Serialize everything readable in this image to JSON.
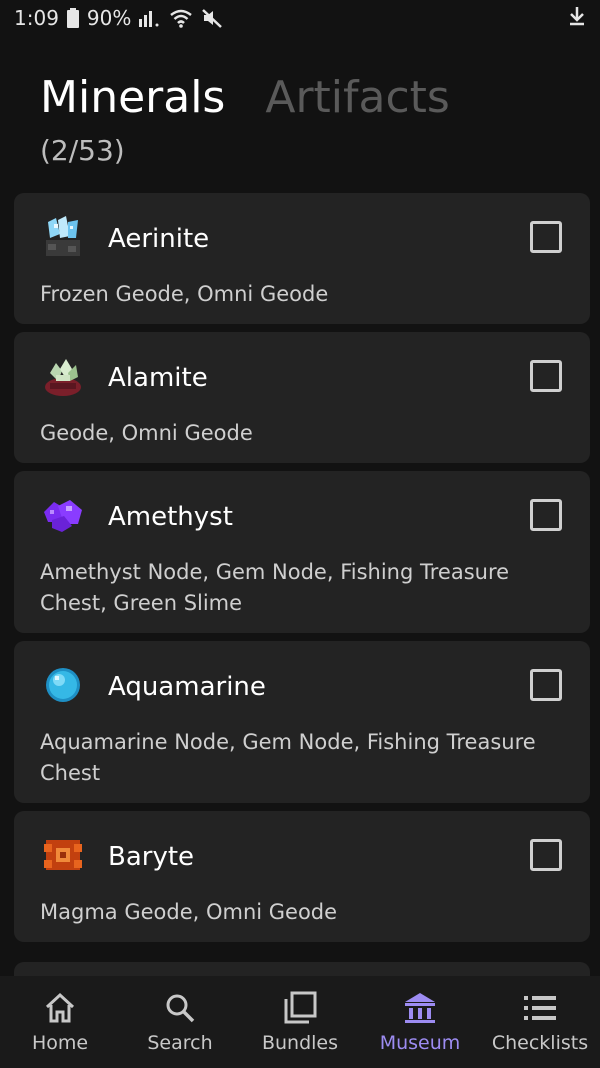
{
  "status_bar": {
    "time": "1:09",
    "battery": "90%",
    "icons": [
      "battery-icon",
      "signal-icon",
      "wifi-icon",
      "mute-icon",
      "download-icon"
    ]
  },
  "header": {
    "tabs": [
      {
        "label": "Minerals",
        "active": true
      },
      {
        "label": "Artifacts",
        "active": false
      }
    ],
    "count": "(2/53)"
  },
  "minerals": [
    {
      "name": "Aerinite",
      "sources": "Frozen Geode, Omni Geode",
      "checked": false,
      "icon": "aerinite-icon",
      "color": "#8fd7f7"
    },
    {
      "name": "Alamite",
      "sources": "Geode, Omni Geode",
      "checked": false,
      "icon": "alamite-icon",
      "color": "#b9d6b0"
    },
    {
      "name": "Amethyst",
      "sources": "Amethyst Node, Gem Node, Fishing Treasure Chest, Green Slime",
      "checked": false,
      "icon": "amethyst-icon",
      "color": "#8a3cff"
    },
    {
      "name": "Aquamarine",
      "sources": "Aquamarine Node, Gem Node, Fishing Treasure Chest",
      "checked": false,
      "icon": "aquamarine-icon",
      "color": "#35b8e6"
    },
    {
      "name": "Baryte",
      "sources": "Magma Geode, Omni Geode",
      "checked": false,
      "icon": "baryte-icon",
      "color": "#e8641e"
    }
  ],
  "nav": [
    {
      "label": "Home",
      "icon": "home-icon",
      "active": false
    },
    {
      "label": "Search",
      "icon": "search-icon",
      "active": false
    },
    {
      "label": "Bundles",
      "icon": "bundles-icon",
      "active": false
    },
    {
      "label": "Museum",
      "icon": "museum-icon",
      "active": true
    },
    {
      "label": "Checklists",
      "icon": "checklist-icon",
      "active": false
    }
  ],
  "colors": {
    "background": "#121212",
    "card": "#232323",
    "accent": "#9d8cf2",
    "inactive_tab": "#5a5a5a"
  }
}
